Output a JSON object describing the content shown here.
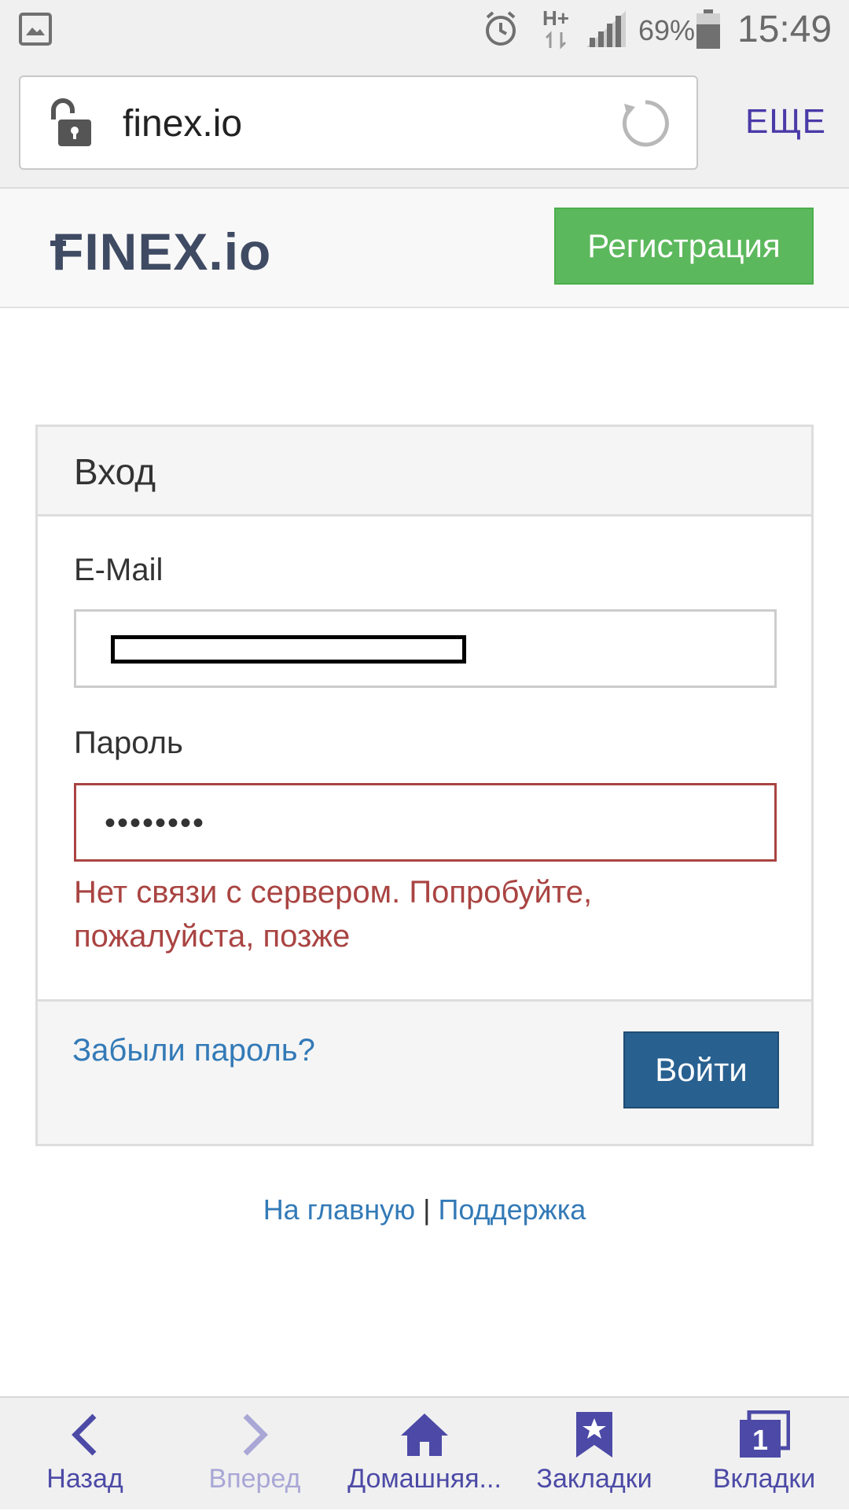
{
  "status_bar": {
    "network": "H+",
    "battery_percent": "69%",
    "time": "15:49"
  },
  "browser": {
    "url": "finex.io",
    "more_label": "ЕЩЕ"
  },
  "site_header": {
    "logo_text": "FINEX",
    "logo_suffix": ".io",
    "register_label": "Регистрация"
  },
  "login_panel": {
    "title": "Вход",
    "email_label": "E-Mail",
    "email_value": "",
    "password_label": "Пароль",
    "password_value": "••••••••",
    "error_message": "Нет связи с сервером. Попробуйте, пожалуйста, позже",
    "forgot_label": "Забыли пароль?",
    "submit_label": "Войти"
  },
  "footer": {
    "home_link": "На главную",
    "separator": "|",
    "support_link": "Поддержка"
  },
  "bottom_nav": {
    "items": [
      {
        "label": "Назад",
        "icon": "back-icon",
        "enabled": true
      },
      {
        "label": "Вперед",
        "icon": "forward-icon",
        "enabled": false
      },
      {
        "label": "Домашняя...",
        "icon": "home-icon",
        "enabled": true
      },
      {
        "label": "Закладки",
        "icon": "bookmarks-icon",
        "enabled": true
      },
      {
        "label": "Вкладки",
        "icon": "tabs-icon",
        "enabled": true,
        "badge": "1"
      }
    ]
  },
  "colors": {
    "accent_nav": "#4c4aa6",
    "register_green": "#5cb85c",
    "login_blue": "#286090",
    "error_red": "#a94442",
    "link_blue": "#337ab7"
  }
}
